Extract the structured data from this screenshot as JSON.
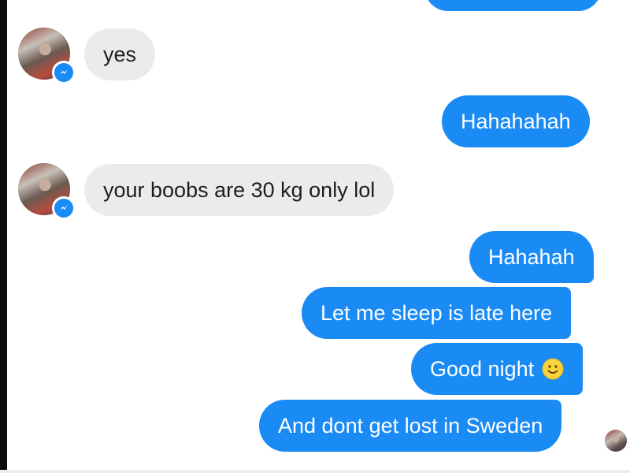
{
  "conversation": {
    "messages": [
      {
        "direction": "incoming",
        "text": "yes"
      },
      {
        "direction": "outgoing",
        "text": "Hahahahah"
      },
      {
        "direction": "incoming",
        "text": "your boobs are 30 kg only lol"
      },
      {
        "direction": "outgoing",
        "text": "Hahahah"
      },
      {
        "direction": "outgoing",
        "text": "Let me sleep is late here"
      },
      {
        "direction": "outgoing",
        "text": "Good night",
        "emoji": "slightly-smiling-face"
      },
      {
        "direction": "outgoing",
        "text": "And dont get lost in Sweden"
      }
    ]
  },
  "icons": {
    "messenger_badge": "messenger-bolt-icon",
    "emoji": "smiley-emoji-icon",
    "read_receipt": "read-receipt-avatar"
  },
  "colors": {
    "outgoing_bubble": "#1a8af5",
    "incoming_bubble": "#ebebeb",
    "incoming_text": "#1d1d1d",
    "outgoing_text": "#ffffff",
    "background": "#ffffff"
  }
}
